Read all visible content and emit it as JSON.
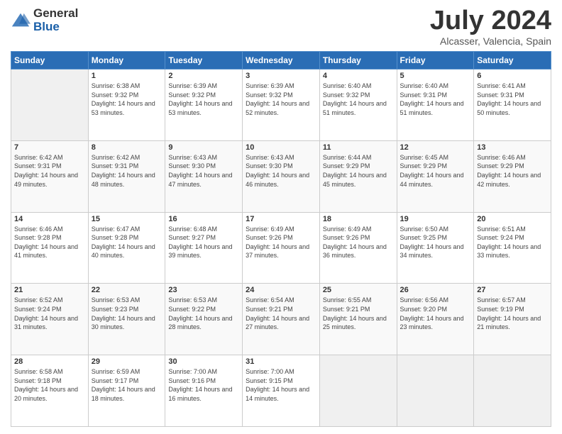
{
  "logo": {
    "general": "General",
    "blue": "Blue"
  },
  "title": {
    "month": "July 2024",
    "location": "Alcasser, Valencia, Spain"
  },
  "days_header": [
    "Sunday",
    "Monday",
    "Tuesday",
    "Wednesday",
    "Thursday",
    "Friday",
    "Saturday"
  ],
  "weeks": [
    [
      {
        "day": "",
        "sunrise": "",
        "sunset": "",
        "daylight": ""
      },
      {
        "day": "1",
        "sunrise": "Sunrise: 6:38 AM",
        "sunset": "Sunset: 9:32 PM",
        "daylight": "Daylight: 14 hours and 53 minutes."
      },
      {
        "day": "2",
        "sunrise": "Sunrise: 6:39 AM",
        "sunset": "Sunset: 9:32 PM",
        "daylight": "Daylight: 14 hours and 53 minutes."
      },
      {
        "day": "3",
        "sunrise": "Sunrise: 6:39 AM",
        "sunset": "Sunset: 9:32 PM",
        "daylight": "Daylight: 14 hours and 52 minutes."
      },
      {
        "day": "4",
        "sunrise": "Sunrise: 6:40 AM",
        "sunset": "Sunset: 9:32 PM",
        "daylight": "Daylight: 14 hours and 51 minutes."
      },
      {
        "day": "5",
        "sunrise": "Sunrise: 6:40 AM",
        "sunset": "Sunset: 9:31 PM",
        "daylight": "Daylight: 14 hours and 51 minutes."
      },
      {
        "day": "6",
        "sunrise": "Sunrise: 6:41 AM",
        "sunset": "Sunset: 9:31 PM",
        "daylight": "Daylight: 14 hours and 50 minutes."
      }
    ],
    [
      {
        "day": "7",
        "sunrise": "Sunrise: 6:42 AM",
        "sunset": "Sunset: 9:31 PM",
        "daylight": "Daylight: 14 hours and 49 minutes."
      },
      {
        "day": "8",
        "sunrise": "Sunrise: 6:42 AM",
        "sunset": "Sunset: 9:31 PM",
        "daylight": "Daylight: 14 hours and 48 minutes."
      },
      {
        "day": "9",
        "sunrise": "Sunrise: 6:43 AM",
        "sunset": "Sunset: 9:30 PM",
        "daylight": "Daylight: 14 hours and 47 minutes."
      },
      {
        "day": "10",
        "sunrise": "Sunrise: 6:43 AM",
        "sunset": "Sunset: 9:30 PM",
        "daylight": "Daylight: 14 hours and 46 minutes."
      },
      {
        "day": "11",
        "sunrise": "Sunrise: 6:44 AM",
        "sunset": "Sunset: 9:29 PM",
        "daylight": "Daylight: 14 hours and 45 minutes."
      },
      {
        "day": "12",
        "sunrise": "Sunrise: 6:45 AM",
        "sunset": "Sunset: 9:29 PM",
        "daylight": "Daylight: 14 hours and 44 minutes."
      },
      {
        "day": "13",
        "sunrise": "Sunrise: 6:46 AM",
        "sunset": "Sunset: 9:29 PM",
        "daylight": "Daylight: 14 hours and 42 minutes."
      }
    ],
    [
      {
        "day": "14",
        "sunrise": "Sunrise: 6:46 AM",
        "sunset": "Sunset: 9:28 PM",
        "daylight": "Daylight: 14 hours and 41 minutes."
      },
      {
        "day": "15",
        "sunrise": "Sunrise: 6:47 AM",
        "sunset": "Sunset: 9:28 PM",
        "daylight": "Daylight: 14 hours and 40 minutes."
      },
      {
        "day": "16",
        "sunrise": "Sunrise: 6:48 AM",
        "sunset": "Sunset: 9:27 PM",
        "daylight": "Daylight: 14 hours and 39 minutes."
      },
      {
        "day": "17",
        "sunrise": "Sunrise: 6:49 AM",
        "sunset": "Sunset: 9:26 PM",
        "daylight": "Daylight: 14 hours and 37 minutes."
      },
      {
        "day": "18",
        "sunrise": "Sunrise: 6:49 AM",
        "sunset": "Sunset: 9:26 PM",
        "daylight": "Daylight: 14 hours and 36 minutes."
      },
      {
        "day": "19",
        "sunrise": "Sunrise: 6:50 AM",
        "sunset": "Sunset: 9:25 PM",
        "daylight": "Daylight: 14 hours and 34 minutes."
      },
      {
        "day": "20",
        "sunrise": "Sunrise: 6:51 AM",
        "sunset": "Sunset: 9:24 PM",
        "daylight": "Daylight: 14 hours and 33 minutes."
      }
    ],
    [
      {
        "day": "21",
        "sunrise": "Sunrise: 6:52 AM",
        "sunset": "Sunset: 9:24 PM",
        "daylight": "Daylight: 14 hours and 31 minutes."
      },
      {
        "day": "22",
        "sunrise": "Sunrise: 6:53 AM",
        "sunset": "Sunset: 9:23 PM",
        "daylight": "Daylight: 14 hours and 30 minutes."
      },
      {
        "day": "23",
        "sunrise": "Sunrise: 6:53 AM",
        "sunset": "Sunset: 9:22 PM",
        "daylight": "Daylight: 14 hours and 28 minutes."
      },
      {
        "day": "24",
        "sunrise": "Sunrise: 6:54 AM",
        "sunset": "Sunset: 9:21 PM",
        "daylight": "Daylight: 14 hours and 27 minutes."
      },
      {
        "day": "25",
        "sunrise": "Sunrise: 6:55 AM",
        "sunset": "Sunset: 9:21 PM",
        "daylight": "Daylight: 14 hours and 25 minutes."
      },
      {
        "day": "26",
        "sunrise": "Sunrise: 6:56 AM",
        "sunset": "Sunset: 9:20 PM",
        "daylight": "Daylight: 14 hours and 23 minutes."
      },
      {
        "day": "27",
        "sunrise": "Sunrise: 6:57 AM",
        "sunset": "Sunset: 9:19 PM",
        "daylight": "Daylight: 14 hours and 21 minutes."
      }
    ],
    [
      {
        "day": "28",
        "sunrise": "Sunrise: 6:58 AM",
        "sunset": "Sunset: 9:18 PM",
        "daylight": "Daylight: 14 hours and 20 minutes."
      },
      {
        "day": "29",
        "sunrise": "Sunrise: 6:59 AM",
        "sunset": "Sunset: 9:17 PM",
        "daylight": "Daylight: 14 hours and 18 minutes."
      },
      {
        "day": "30",
        "sunrise": "Sunrise: 7:00 AM",
        "sunset": "Sunset: 9:16 PM",
        "daylight": "Daylight: 14 hours and 16 minutes."
      },
      {
        "day": "31",
        "sunrise": "Sunrise: 7:00 AM",
        "sunset": "Sunset: 9:15 PM",
        "daylight": "Daylight: 14 hours and 14 minutes."
      },
      {
        "day": "",
        "sunrise": "",
        "sunset": "",
        "daylight": ""
      },
      {
        "day": "",
        "sunrise": "",
        "sunset": "",
        "daylight": ""
      },
      {
        "day": "",
        "sunrise": "",
        "sunset": "",
        "daylight": ""
      }
    ]
  ]
}
